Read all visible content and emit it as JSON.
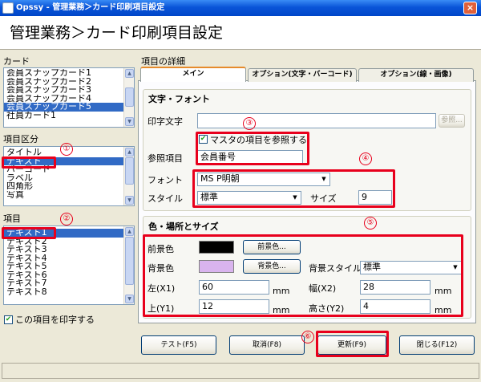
{
  "window": {
    "title": "Opssy - 管理業務＞カード印刷項目設定",
    "close": "×"
  },
  "page_title": "管理業務＞カード印刷項目設定",
  "card": {
    "label": "カード",
    "items": [
      "会員スナップカード1",
      "会員スナップカード2",
      "会員スナップカード3",
      "会員スナップカード4",
      "会員スナップカード5",
      "社員カード1"
    ],
    "selected_index": 4
  },
  "item_category": {
    "label": "項目区分",
    "items": [
      "タイトル",
      "テキスト",
      "バーコード",
      "ラベル",
      "四角形",
      "写真"
    ],
    "selected_index": 1
  },
  "item": {
    "label": "項目",
    "items": [
      "テキスト1",
      "テキスト2",
      "テキスト3",
      "テキスト4",
      "テキスト5",
      "テキスト6",
      "テキスト7",
      "テキスト8"
    ],
    "selected_index": 0
  },
  "print_item_checkbox": {
    "label": "この項目を印字する",
    "checked": true
  },
  "details": {
    "label": "項目の詳細",
    "tabs": [
      "メイン",
      "オプション(文字・バーコード)",
      "オプション(線・画像)"
    ],
    "active_tab": 0
  },
  "text_font": {
    "section_label": "文字・フォント",
    "print_text_label": "印字文字",
    "print_text_value": "",
    "ref_button": "参照...",
    "master_ref_label": "マスタの項目を参照する",
    "master_ref_checked": true,
    "ref_item_label": "参照項目",
    "ref_item_value": "会員番号",
    "font_label": "フォント",
    "font_value": "MS P明朝",
    "style_label": "スタイル",
    "style_value": "標準",
    "size_label": "サイズ",
    "size_value": "9"
  },
  "color_pos": {
    "section_label": "色・場所とサイズ",
    "fg_label": "前景色",
    "fg_color": "#000000",
    "fg_button": "前景色...",
    "bg_label": "背景色",
    "bg_color": "#d9b4ee",
    "bg_button": "背景色...",
    "bg_style_label": "背景スタイル",
    "bg_style_value": "標準",
    "x1_label": "左(X1)",
    "x1_value": "60",
    "x2_label": "幅(X2)",
    "x2_value": "28",
    "y1_label": "上(Y1)",
    "y1_value": "12",
    "y2_label": "高さ(Y2)",
    "y2_value": "4",
    "unit": "mm"
  },
  "buttons": {
    "test": "テスト(F5)",
    "cancel": "取消(F8)",
    "update": "更新(F9)",
    "close": "閉じる(F12)"
  },
  "markers": [
    "①",
    "②",
    "③",
    "④",
    "⑤",
    "⑥"
  ],
  "highlight_color": "#e8001c"
}
